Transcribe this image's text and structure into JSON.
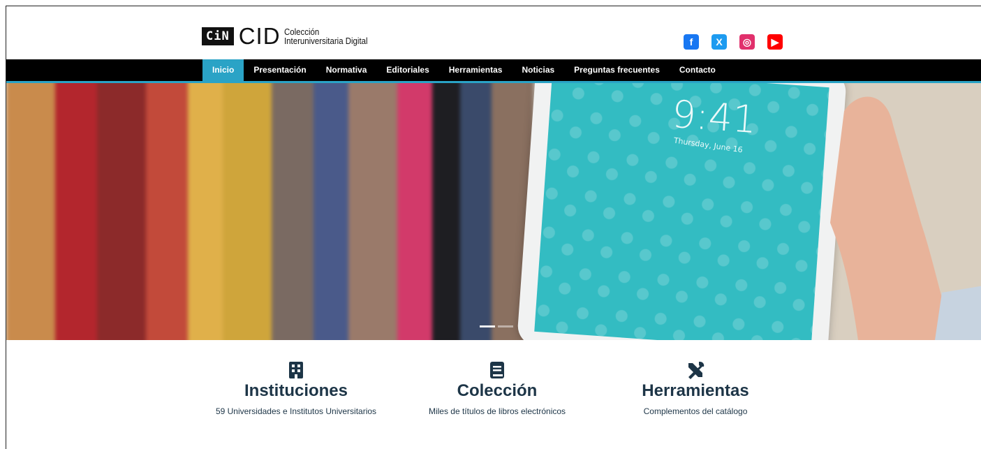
{
  "header": {
    "logo_badge": "CiN",
    "logo_main": "CID",
    "logo_sub_line1": "Colección",
    "logo_sub_line2": "Interuniversitaria Digital"
  },
  "socials": [
    {
      "name": "facebook-icon",
      "glyph": "f"
    },
    {
      "name": "x-icon",
      "glyph": "X"
    },
    {
      "name": "instagram-icon",
      "glyph": "◎"
    },
    {
      "name": "youtube-icon",
      "glyph": "▶"
    }
  ],
  "nav": {
    "items": [
      {
        "label": "Inicio",
        "active": true
      },
      {
        "label": "Presentación"
      },
      {
        "label": "Normativa"
      },
      {
        "label": "Editoriales"
      },
      {
        "label": "Herramientas"
      },
      {
        "label": "Noticias"
      },
      {
        "label": "Preguntas frecuentes"
      },
      {
        "label": "Contacto"
      }
    ]
  },
  "hero": {
    "clock": "9:41",
    "date": "Thursday, June 16",
    "slides_total": 2,
    "slide_active": 1
  },
  "features": [
    {
      "icon": "building-icon",
      "title": "Instituciones",
      "desc": "59 Universidades e Institutos Universitarios"
    },
    {
      "icon": "book-icon",
      "title": "Colección",
      "desc": "Miles de títulos de libros electrónicos"
    },
    {
      "icon": "tools-icon",
      "title": "Herramientas",
      "desc": "Complementos del catálogo"
    }
  ],
  "colors": {
    "accent": "#2aa3c6",
    "nav_bg": "#000000",
    "text_dark": "#1d3547",
    "tablet_screen": "#33bcc2"
  }
}
